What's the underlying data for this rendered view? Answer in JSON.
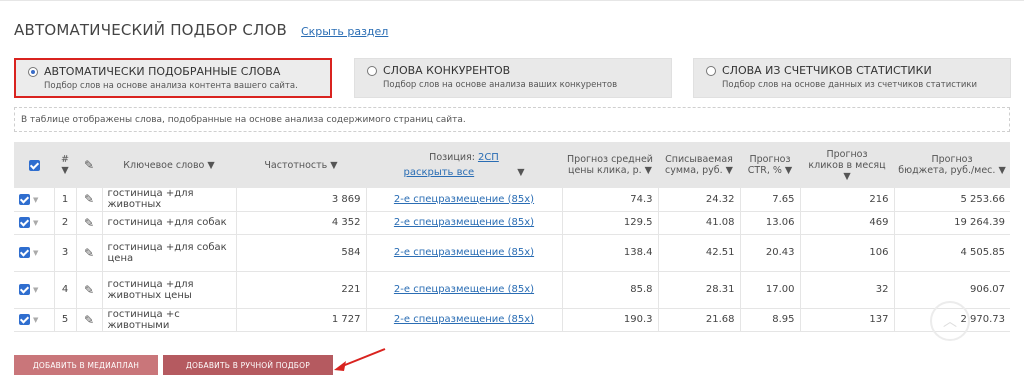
{
  "section": {
    "title": "АВТОМАТИЧЕСКИЙ ПОДБОР СЛОВ",
    "hide_link": "Скрыть раздел"
  },
  "modes": [
    {
      "label": "АВТОМАТИЧЕСКИ ПОДОБРАННЫЕ СЛОВА",
      "desc": "Подбор слов на основе анализа контента вашего сайта.",
      "selected": true
    },
    {
      "label": "СЛОВА КОНКУРЕНТОВ",
      "desc": "Подбор слов на основе анализа ваших конкурентов",
      "selected": false
    },
    {
      "label": "СЛОВА ИЗ СЧЕТЧИКОВ СТАТИСТИКИ",
      "desc": "Подбор слов на основе данных из счетчиков статистики",
      "selected": false
    }
  ],
  "info": "В таблице отображены слова, подобранные на основе анализа содержимого страниц сайта.",
  "table": {
    "headers": {
      "num": "# ▼",
      "keyword": "Ключевое слово ▼",
      "freq": "Частотность ▼",
      "position_label": "Позиция:",
      "position_link": "2СП",
      "expand_all": "раскрыть все",
      "position_arrow": "▼",
      "cpc_l1": "Прогноз средней",
      "cpc_l2": "цены клика, р. ▼",
      "spend_l1": "Списываемая",
      "spend_l2": "сумма, руб. ▼",
      "ctr_l1": "Прогноз",
      "ctr_l2": "CTR, % ▼",
      "clicks_l1": "Прогноз",
      "clicks_l2": "кликов в месяц ▼",
      "budget_l1": "Прогноз",
      "budget_l2": "бюджета, руб./мес. ▼"
    },
    "rows": [
      {
        "n": "1",
        "keyword": "гостиница +для животных",
        "freq": "3 869",
        "position": "2-е спецразмещение (85х)",
        "cpc": "74.3",
        "spend": "24.32",
        "ctr": "7.65",
        "clicks": "216",
        "budget": "5 253.66"
      },
      {
        "n": "2",
        "keyword": "гостиница +для собак",
        "freq": "4 352",
        "position": "2-е спецразмещение (85х)",
        "cpc": "129.5",
        "spend": "41.08",
        "ctr": "13.06",
        "clicks": "469",
        "budget": "19 264.39"
      },
      {
        "n": "3",
        "keyword": "гостиница +для собак цена",
        "freq": "584",
        "position": "2-е спецразмещение (85х)",
        "cpc": "138.4",
        "spend": "42.51",
        "ctr": "20.43",
        "clicks": "106",
        "budget": "4 505.85"
      },
      {
        "n": "4",
        "keyword": "гостиница +для животных цены",
        "freq": "221",
        "position": "2-е спецразмещение (85х)",
        "cpc": "85.8",
        "spend": "28.31",
        "ctr": "17.00",
        "clicks": "32",
        "budget": "906.07"
      },
      {
        "n": "5",
        "keyword": "гостиница +с животными",
        "freq": "1 727",
        "position": "2-е спецразмещение (85х)",
        "cpc": "190.3",
        "spend": "21.68",
        "ctr": "8.95",
        "clicks": "137",
        "budget": "2 970.73"
      }
    ]
  },
  "buttons": {
    "add_mediaplan": "ДОБАВИТЬ В МЕДИАПЛАН",
    "add_manual": "ДОБАВИТЬ В РУЧНОЙ ПОДБОР"
  },
  "colors": {
    "accent": "#2a6db4",
    "highlight_border": "#d9231f",
    "button": "#c9767a",
    "arrow": "#d9231f"
  }
}
